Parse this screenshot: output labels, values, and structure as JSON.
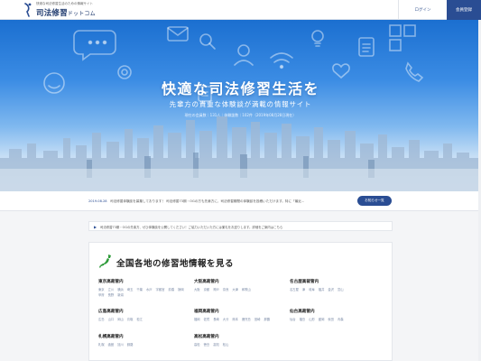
{
  "header": {
    "tagline": "快適な司法修習生活のための情報サイト",
    "logo_main": "司法修習",
    "logo_suffix": "ドットコム",
    "login_label": "ログイン",
    "register_label": "会員登録"
  },
  "hero": {
    "title": "快適な司法修習生活を",
    "subtitle": "先輩方の貴重な体験談が満載の情報サイト",
    "stats": "現在の会員数｜131人｜体験談数｜102件（2019年08月28日現在）"
  },
  "news": {
    "date": "2019.08.28",
    "text": "司法修習体験談を募集しております！ 司法修習73期・OGの方も先輩方に、司法修習期間の体験談を投稿いただけます。特に「最近...",
    "button_label": "お知らせ一覧"
  },
  "notice": {
    "text": "司法修習73期・OGの先輩方、ぜひ体験談を公開してください！ご協力いただいた方には謝礼をお送りします。詳細をご案内はこちら"
  },
  "regions_section": {
    "title": "全国各地の修習地情報を見る",
    "regions": [
      {
        "title": "東京高裁管内",
        "places": [
          "東京",
          "立川",
          "横浜",
          "埼玉",
          "千葉",
          "水戸",
          "宇都宮",
          "前橋",
          "静岡",
          "甲府",
          "長野",
          "新潟"
        ]
      },
      {
        "title": "大阪高裁管内",
        "places": [
          "大阪",
          "京都",
          "神戸",
          "奈良",
          "大津",
          "和歌山"
        ]
      },
      {
        "title": "名古屋高裁管内",
        "places": [
          "名古屋",
          "津",
          "岐阜",
          "福井",
          "金沢",
          "富山"
        ]
      },
      {
        "title": "広島高裁管内",
        "places": [
          "広島",
          "山口",
          "岡山",
          "鳥取",
          "松江"
        ]
      },
      {
        "title": "福岡高裁管内",
        "places": [
          "福岡",
          "佐賀",
          "長崎",
          "大分",
          "熊本",
          "鹿児島",
          "宮崎",
          "那覇"
        ]
      },
      {
        "title": "仙台高裁管内",
        "places": [
          "仙台",
          "福島",
          "山形",
          "盛岡",
          "秋田",
          "青森"
        ]
      },
      {
        "title": "札幌高裁管内",
        "places": [
          "札幌",
          "函館",
          "旭川",
          "釧路"
        ]
      },
      {
        "title": "高松高裁管内",
        "places": [
          "高松",
          "徳島",
          "高知",
          "松山"
        ]
      }
    ]
  },
  "icons": {
    "menu": "hamburger-menu-icon",
    "notice": "megaphone-icon",
    "map": "japan-map-icon"
  },
  "colors": {
    "brand_navy": "#2a4d93",
    "hero_sky": "#3b8ce4",
    "map_green": "#2f9b3a"
  }
}
